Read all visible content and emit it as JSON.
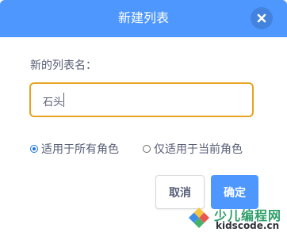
{
  "dialog": {
    "title": "新建列表",
    "close_icon": "close-icon",
    "field_label": "新的列表名：",
    "input_value": "石头",
    "options": [
      {
        "label": "适用于所有角色",
        "checked": true
      },
      {
        "label": "仅适用于当前角色",
        "checked": false
      }
    ],
    "cancel_label": "取消",
    "ok_label": "确定"
  },
  "watermark": {
    "title": "少儿编程网",
    "subtitle": "kidscode.cn"
  },
  "colors": {
    "header": "#4d97ff",
    "input_border": "#e8a421",
    "text": "#575e75",
    "primary_button": "#4d97ff"
  }
}
